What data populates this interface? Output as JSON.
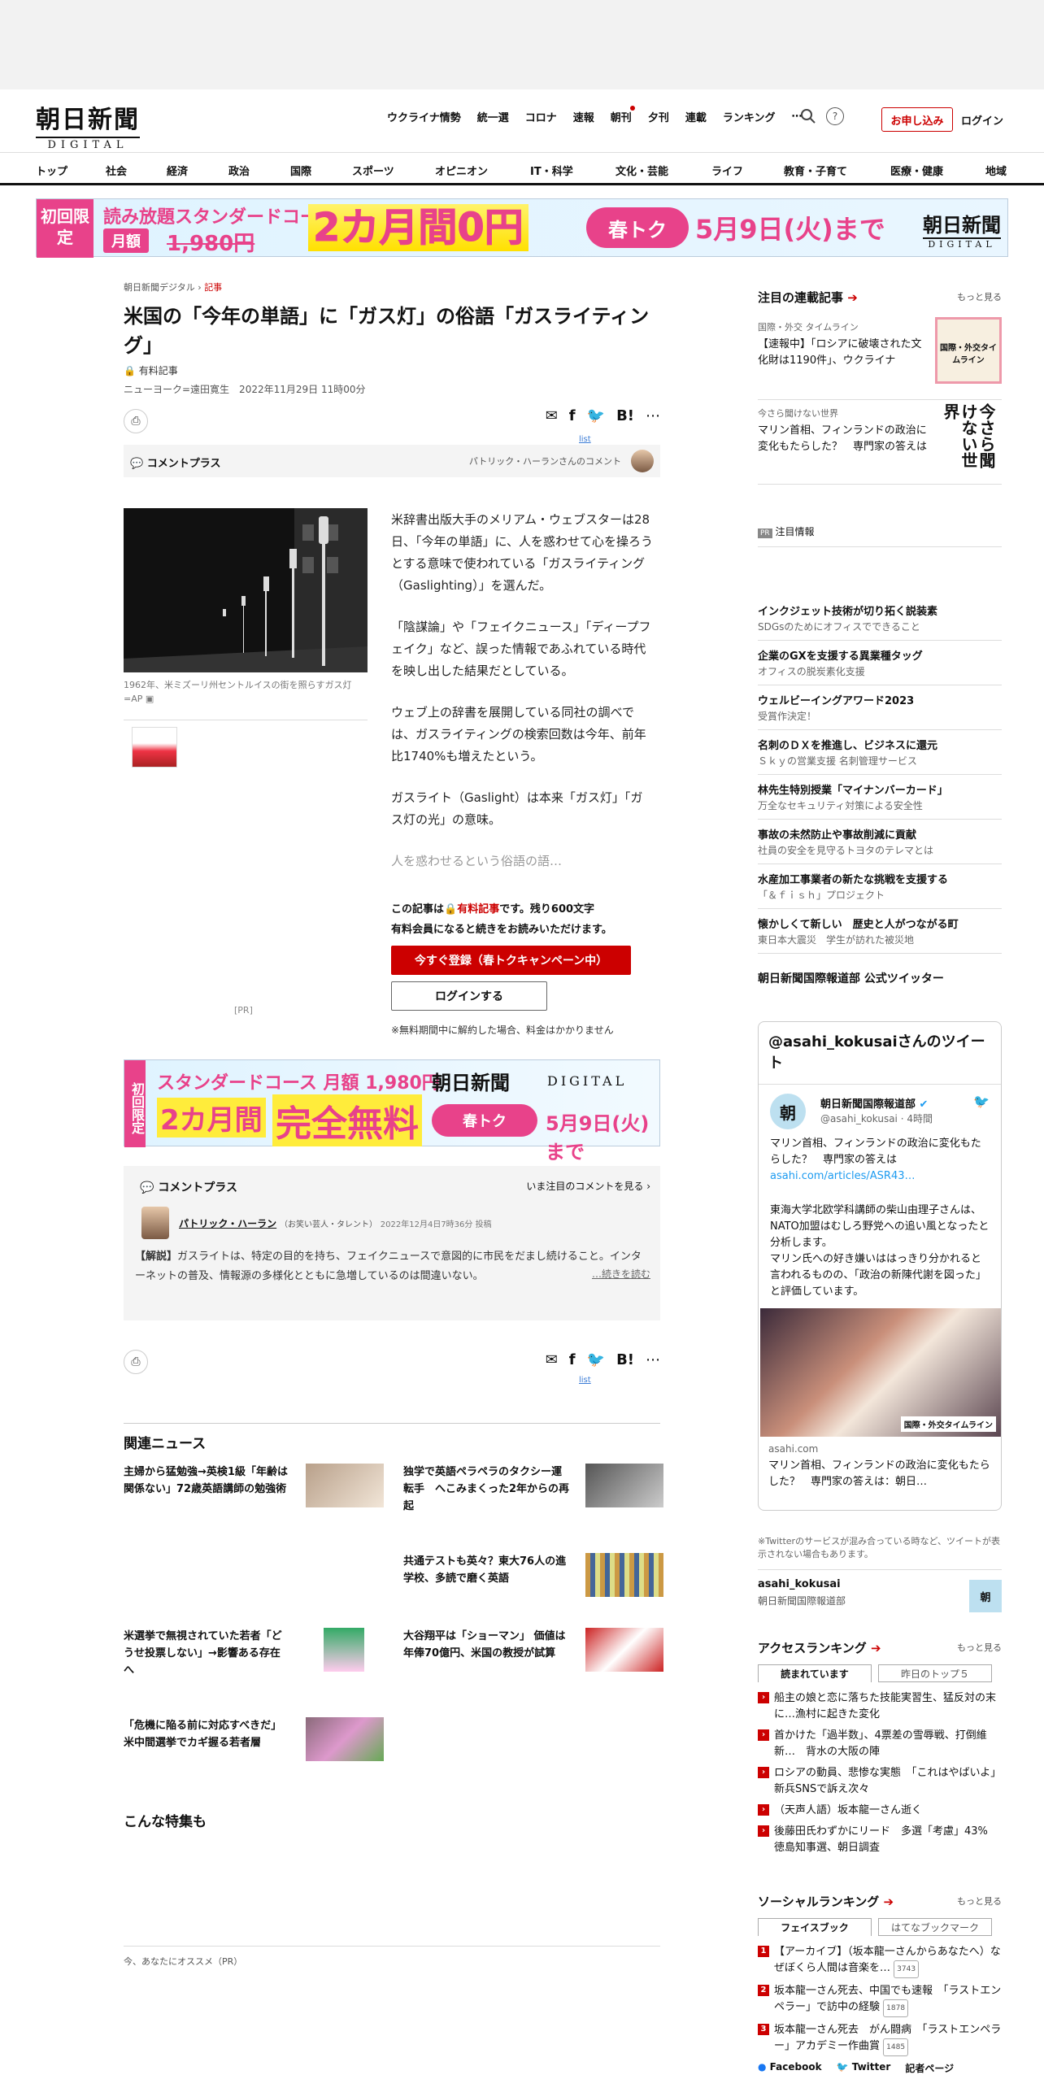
{
  "header": {
    "logo_main": "朝日新聞",
    "logo_sub": "DIGITAL",
    "nav": [
      "ウクライナ情勢",
      "統一選",
      "コロナ",
      "速報",
      "朝刊",
      "夕刊",
      "連載",
      "ランキング"
    ],
    "more_icon": "⋯",
    "subscribe": "お申し込み",
    "login": "ログイン"
  },
  "categories": [
    "トップ",
    "社会",
    "経済",
    "政治",
    "国際",
    "スポーツ",
    "オピニオン",
    "IT・科学",
    "文化・芸能",
    "ライフ",
    "教育・子育て",
    "医療・健康",
    "地域"
  ],
  "banner_top": {
    "limited": "初回限定",
    "title": "読み放題スタンダードコース",
    "monthly": "月額",
    "old_price": "1,980円",
    "promo": "2カ月間0円",
    "pill": "春トク",
    "until": "5月9日(火)まで",
    "logo_main": "朝日新聞",
    "logo_sub": "DIGITAL"
  },
  "article": {
    "crumb_site": "朝日新聞デジタル",
    "crumb_sep": "›",
    "crumb_section": "記事",
    "title": "米国の「今年の単語」に「ガス灯」の俗語「ガスライティング」",
    "paid": "有料記事",
    "byline": "ニューヨーク=遠田寛生　2022年11月29日 11時00分",
    "list_label": "list",
    "comment_plus": "コメントプラス",
    "comment_by": "パトリック・ハーランさんのコメント",
    "caption": "1962年、米ミズーリ州セントルイスの街を照らすガス灯=AP",
    "paragraphs": [
      "米辞書出版大手のメリアム・ウェブスターは28日、「今年の単語」に、人を惑わせて心を操ろうとする意味で使われている「ガスライティング（Gaslighting）」を選んだ。",
      "「陰謀論」や「フェイクニュース」「ディープフェイク」など、誤った情報であふれている時代を映し出した結果だとしている。",
      "ウェブ上の辞書を展開している同社の調べでは、ガスライティングの検索回数は今年、前年比1740%も増えたという。",
      "ガスライト（Gaslight）は本来「ガス灯」「ガス灯の光」の意味。"
    ],
    "faded": "人を惑わせるという俗語の語…",
    "paywall_1": "この記事は",
    "paywall_red": "有料記事",
    "paywall_2": "です。残り600文字",
    "paywall_3": "有料会員になると続きをお読みいただけます。",
    "register_btn": "今すぐ登録（春トクキャンペーン中）",
    "login_btn": "ログインする",
    "note": "※無料期間中に解約した場合、料金はかかりません",
    "pr": "[PR]"
  },
  "banner_mid": {
    "limited": "初回限定",
    "line1": "スタンダードコース 月額 1,980円",
    "line2": "2カ月間",
    "line3": "完全無料",
    "pill": "春トク",
    "until": "5月9日(火)まで",
    "logo_main": "朝日新聞",
    "logo_sub": "DIGITAL"
  },
  "comment_box": {
    "label": "コメントプラス",
    "more": "いま注目のコメントを見る",
    "author": "パトリック・ハーラン",
    "role": "（お笑い芸人・タレント）",
    "time": "2022年12月4日7時36分 投稿",
    "tag": "【解説】",
    "text": "ガスライトは、特定の目的を持ち、フェイクニュースで意図的に市民をだまし続けること。インターネットの普及、情報源の多様化とともに急増しているのは間違いない。",
    "read_more": "…続きを読む"
  },
  "related": {
    "title": "関連ニュース",
    "items": [
      "主婦から猛勉強→英検1級「年齢は関係ない」72歳英語講師の勉強術",
      "独学で英語ペラペラのタクシー運転手　へこみまくった2年からの再起",
      "共通テストも英々？東大76人の進学校、多読で磨く英語",
      "米選挙で無視されていた若者「どうせ投票しない」→影響ある存在へ",
      "大谷翔平は「ショーマン」 価値は年俸70億円、米国の教授が試算",
      "「危機に陥る前に対応すべきだ」　米中間選挙でカギ握る若者層"
    ],
    "feature": "こんな特集も",
    "recommend": "今、あなたにオススメ（PR）"
  },
  "sidebar": {
    "series_title": "注目の連載記事",
    "more": "もっと見る",
    "series": [
      {
        "cat": "国際・外交 タイムライン",
        "title": "【速報中】「ロシアに破壊された文化財は1190件」、ウクライナ",
        "img": "国際・外交タイムライン"
      },
      {
        "cat": "今さら聞けない世界",
        "title": "マリン首相、フィンランドの政治に変化もたらした？　専門家の答えは",
        "img": "今さら聞けない世界"
      }
    ],
    "pr_badge": "PR",
    "notice": "注目情報",
    "ads": [
      {
        "t": "インクジェット技術が切り拓く説装素",
        "s": "SDGsのためにオフィスでできること"
      },
      {
        "t": "企業のGXを支援する異業種タッグ",
        "s": "オフィスの脱炭素化支援"
      },
      {
        "t": "ウェルビーイングアワード2023",
        "s": "受賞作決定！"
      },
      {
        "t": "名刺のＤＸを推進し、ビジネスに還元",
        "s": "Ｓｋｙの営業支援 名刺管理サービス"
      },
      {
        "t": "林先生特別授業「マイナンバーカード」",
        "s": "万全なセキュリティ対策による安全性"
      },
      {
        "t": "事故の未然防止や事故削減に貢献",
        "s": "社員の安全を見守るトヨタのテレマとは"
      },
      {
        "t": "水産加工事業者の新たな挑戦を支援する",
        "s": "「＆ｆｉｓｈ」プロジェクト"
      },
      {
        "t": "懐かしくて新しい　歴史と人がつながる町",
        "s": "東日本大震災　学生が訪れた被災地"
      }
    ],
    "twitter_title": "朝日新聞国際報道部 公式ツイッター",
    "tw_head": "@asahi_kokusaiさんのツイート",
    "tw_avatar": "朝",
    "tw_name": "朝日新聞国際報道部",
    "tw_handle": "@asahi_kokusai · 4時間",
    "tw_text1": "マリン首相、フィンランドの政治に変化もたらした？　専門家の答えは",
    "tw_link": "asahi.com/articles/ASR43…",
    "tw_text2": "東海大学北欧学科講師の柴山由理子さんは、NATO加盟はむしろ野党への追い風となったと分析します。\nマリン氏への好き嫌いははっきり分かれると言われるものの、「政治の新陳代謝を図った」と評価しています。",
    "tw_card_domain": "asahi.com",
    "tw_card_title": "マリン首相、フィンランドの政治に変化もたらした？　専門家の答えは：朝日…",
    "tw_note": "※Twitterのサービスが混み合っている時など、ツイートが表示されない場合もあります。",
    "tw_acc": "asahi_kokusai",
    "tw_acc_name": "朝日新聞国際報道部",
    "access_title": "アクセスランキング",
    "tab_now": "読まれています",
    "tab_yest": "昨日のトップ５",
    "access": [
      "船主の娘と恋に落ちた技能実習生、猛反対の末に…漁村に起きた変化",
      "首かけた「過半数」、4票差の雪辱戦、打倒維新…　背水の大阪の陣",
      "ロシアの動員、悲惨な実態　「これはやばいよ」新兵SNSで訴え次々",
      "（天声人語）坂本龍一さん逝く",
      "後藤田氏わずかにリード　多選「考慮」43%　徳島知事選、朝日調査"
    ],
    "social_title": "ソーシャルランキング",
    "tab_fb": "フェイスブック",
    "tab_hb": "はてなブックマーク",
    "social": [
      {
        "t": "【アーカイブ】（坂本龍一さんからあなたへ）なぜぼくら人間は音楽を…",
        "c": "3743"
      },
      {
        "t": "坂本龍一さん死去、中国でも速報　「ラストエンペラー」で訪中の経験",
        "c": "1878"
      },
      {
        "t": "坂本龍一さん死去　がん闘病　「ラストエンペラー」アカデミー作曲賞",
        "c": "1485"
      }
    ],
    "fb": "Facebook",
    "twitter": "Twitter",
    "reporter": "記者ページ"
  }
}
